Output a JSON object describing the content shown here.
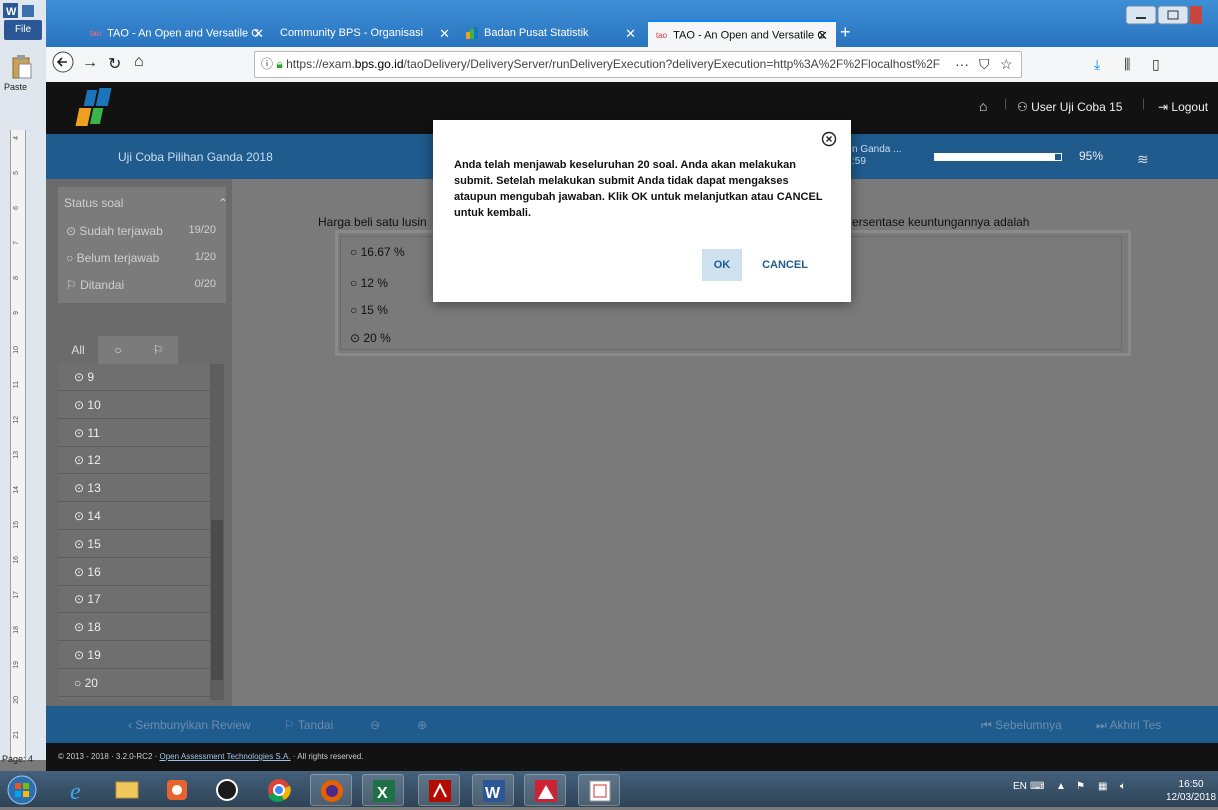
{
  "word": {
    "file_label": "File",
    "paste_label": "Paste",
    "page_label": "Page: 4",
    "ruler_ticks": [
      "4",
      "5",
      "6",
      "7",
      "8",
      "9",
      "10",
      "11",
      "12",
      "13",
      "14",
      "15",
      "16",
      "17",
      "18",
      "19",
      "20",
      "21"
    ]
  },
  "browser": {
    "tabs": [
      {
        "label": "TAO - An Open and Versatile C",
        "icon": "tao-icon",
        "active": false
      },
      {
        "label": "Community BPS - Organisasi",
        "icon": "none",
        "active": false
      },
      {
        "label": "Badan Pusat Statistik",
        "icon": "bps-icon",
        "active": false
      },
      {
        "label": "TAO - An Open and Versatile C",
        "icon": "tao-icon",
        "active": true
      }
    ],
    "url_prefix": "https://exam.",
    "url_domain": "bps.go.id",
    "url_rest": "/taoDelivery/DeliveryServer/runDeliveryExecution?deliveryExecution=http%3A%2F%2Flocalhost%2F",
    "url_more": "···"
  },
  "header": {
    "user_label": "User Uji Coba 15",
    "logout_label": "Logout"
  },
  "subheader": {
    "title": "Uji Coba Pilihan Ganda 2018",
    "truncated_title": "n Ganda ...",
    "timer": ":59",
    "progress_percent": 95,
    "progress_label": "95%"
  },
  "sidebar": {
    "status_heading": "Status soal",
    "status_rows": [
      {
        "label": "Sudah terjawab",
        "count": "19/20",
        "icon": "radio-checked-icon"
      },
      {
        "label": "Belum terjawab",
        "count": "1/20",
        "icon": "radio-empty-icon"
      },
      {
        "label": "Ditandai",
        "count": "0/20",
        "icon": "flag-icon"
      }
    ],
    "tabs": {
      "all": "All",
      "unanswered": "○",
      "flagged": "⚐"
    },
    "questions": [
      {
        "num": "9",
        "answered": true
      },
      {
        "num": "10",
        "answered": true
      },
      {
        "num": "11",
        "answered": true
      },
      {
        "num": "12",
        "answered": true
      },
      {
        "num": "13",
        "answered": true
      },
      {
        "num": "14",
        "answered": true
      },
      {
        "num": "15",
        "answered": true
      },
      {
        "num": "16",
        "answered": true
      },
      {
        "num": "17",
        "answered": true
      },
      {
        "num": "18",
        "answered": true
      },
      {
        "num": "19",
        "answered": true
      },
      {
        "num": "20",
        "answered": false
      }
    ]
  },
  "question": {
    "text_left": "Harga beli satu lusin",
    "text_right": "ersentase keuntungannya adalah",
    "choices": [
      {
        "label": "16.67 %",
        "selected": false
      },
      {
        "label": "12 %",
        "selected": false
      },
      {
        "label": "15 %",
        "selected": false
      },
      {
        "label": "20 %",
        "selected": true
      }
    ]
  },
  "footer": {
    "hide_review": "‹  Sembunyikan Review",
    "flag": "Tandai",
    "prev": "Sebelumnya",
    "end": "Akhiri Tes",
    "copyright_pre": "© 2013 - 2018 · 3.2.0-RC2 · ",
    "copyright_link": "Open Assessment Technologies S.A.",
    "copyright_post": " · All rights reserved."
  },
  "modal": {
    "message": "Anda telah menjawab keseluruhan 20 soal. Anda akan melakukan submit. Setelah melakukan submit Anda tidak dapat mengakses ataupun mengubah jawaban. Klik OK untuk melanjutkan atau CANCEL untuk kembali.",
    "ok_label": "OK",
    "cancel_label": "CANCEL"
  },
  "taskbar": {
    "lang": "EN",
    "time": "16:50",
    "date": "12/03/2018"
  },
  "colors": {
    "tao_blue": "#1f5b8d",
    "header_black": "#121212",
    "overlay_gray": "#7a7a7a",
    "ok_bg": "#cfe0ef"
  }
}
